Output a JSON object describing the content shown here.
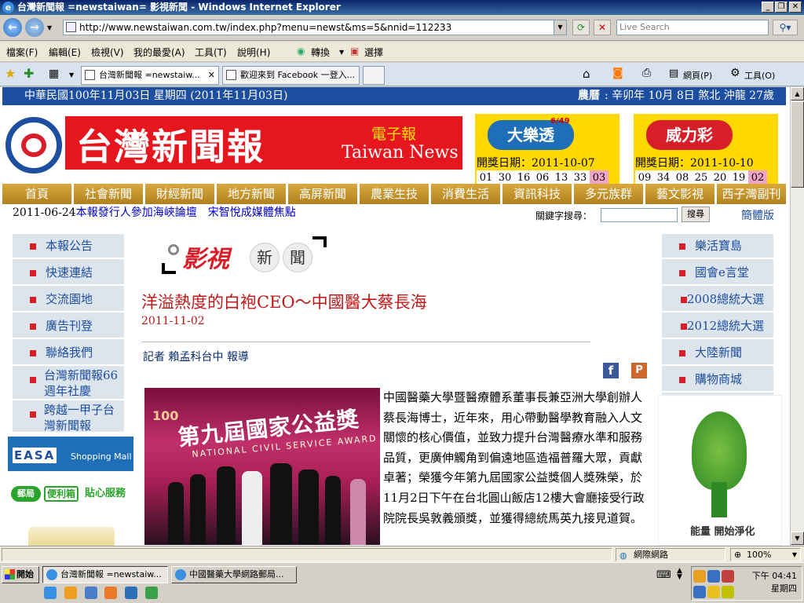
{
  "window": {
    "title": "台灣新聞報 =newstaiwan= 影視新聞 - Windows Internet Explorer",
    "buttons": [
      "_",
      "❐",
      "✕"
    ]
  },
  "browser": {
    "url": "http://www.newstaiwan.com.tw/index.php?menu=newst&ms=5&nnid=112233",
    "search_placeholder": "Live Search",
    "menus": [
      "檔案(F)",
      "編輯(E)",
      "檢視(V)",
      "我的最愛(A)",
      "工具(T)",
      "說明(H)"
    ],
    "translate_label": "轉換",
    "select_label": "選擇",
    "tabs": [
      {
        "label": "台灣新聞報 =newstaiw...",
        "active": true
      },
      {
        "label": "歡迎來到 Facebook 一登入...",
        "active": false
      }
    ],
    "page_menu": "網頁(P)",
    "tools_menu": "工具(O)"
  },
  "page": {
    "date_left": "中華民國100年11月03日 星期四 (2011年11月03日)",
    "lunar_label": "農曆",
    "date_right": ": 辛卯年 10月 8日 煞北 沖龍 27歲",
    "logo": {
      "name": "台灣新聞報",
      "sub": "電子報",
      "english": "Taiwan News"
    },
    "lotto": [
      {
        "name": "大樂透",
        "badge": "6/49",
        "date_label": "開獎日期：2011-10-07",
        "numbers": [
          "01",
          "30",
          "16",
          "06",
          "13",
          "33"
        ],
        "special": "03",
        "color": "#1e6fb8"
      },
      {
        "name": "威力彩",
        "date_label": "開獎日期：2011-10-10",
        "numbers": [
          "09",
          "34",
          "08",
          "25",
          "20",
          "19"
        ],
        "special": "02",
        "color": "#d81e28"
      }
    ],
    "nav": [
      "首頁",
      "社會新聞",
      "財經新聞",
      "地方新聞",
      "高屏新聞",
      "農業生技",
      "消費生活",
      "資訊科技",
      "多元族群",
      "藝文影視",
      "西子灣副刊"
    ],
    "ticker_date": "2011-06-24",
    "ticker_text": "本報發行人參加海峽論壇　宋智悅成媒體焦點",
    "keyword_label": "關鍵字搜尋：",
    "search_button": "搜尋",
    "simplified_label": "簡體版",
    "left_nav": [
      "本報公告",
      "快速連結",
      "交流園地",
      "廣告刊登",
      "聯絡我們",
      "台灣新聞報66週年社慶",
      "跨越一甲子台灣新聞報"
    ],
    "easa_ad": {
      "brand": "EASA",
      "sub": "Shopping Mall"
    },
    "post_ad": {
      "a": "郵局",
      "b": "便利箱",
      "c": "貼心服務"
    },
    "section": {
      "title1": "影視",
      "c1": "新",
      "c2": "聞"
    },
    "article": {
      "headline": "洋溢熱度的白袍CEO～中國醫大蔡長海",
      "date": "2011-11-02",
      "reporter": "記者 賴孟科台中 報導",
      "photo_title": "第九屆國家公益獎",
      "photo_en": "NATIONAL CIVIL SERVICE AWARD",
      "body": "中國醫藥大學暨醫療體系董事長兼亞洲大學創辦人蔡長海博士，近年來，用心帶動醫學教育融入人文關懷的核心價值，並致力提升台灣醫療水準和服務品質，更廣伸觸角到偏遠地區造福普羅大眾，貢獻卓著；榮獲今年第九屆國家公益獎個人獎殊榮，於11月2日下午在台北圓山飯店12樓大會廳接受行政院院長吳敦義頒獎，並獲得總統馬英九接見道賀。"
    },
    "right_nav": [
      "樂活寶島",
      "國會e言堂",
      "2008總統大選",
      "2012總統大選",
      "大陸新聞",
      "購物商城"
    ],
    "green_ad": {
      "text": "能量  開始淨化"
    }
  },
  "status": {
    "zone": "網際網路",
    "zoom": "100%"
  },
  "taskbar": {
    "start": "開始",
    "tasks": [
      {
        "label": "台灣新聞報 =newstaiw...",
        "active": true
      },
      {
        "label": "中國醫藥大學網路郵局...",
        "active": false
      }
    ],
    "time": "下午 04:41",
    "day": "星期四"
  }
}
